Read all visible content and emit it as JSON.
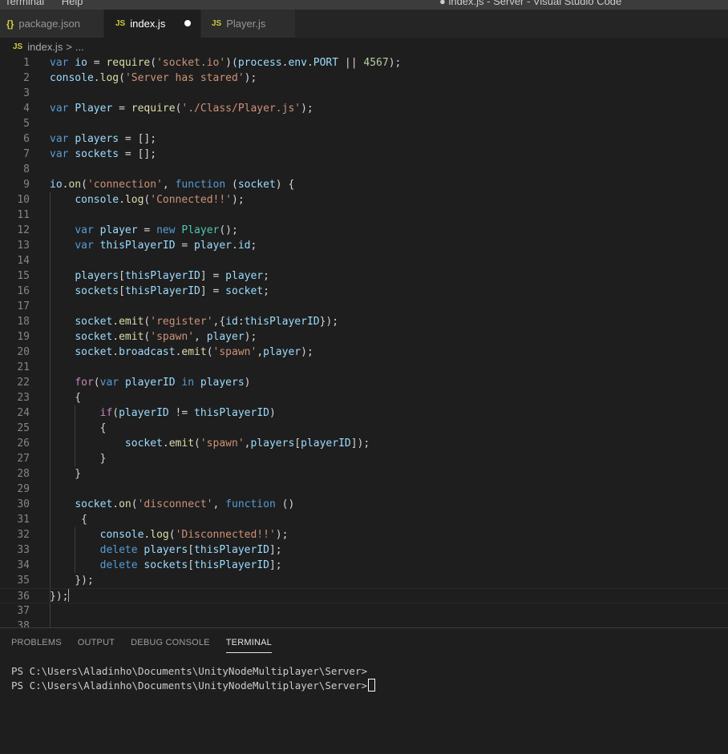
{
  "menu": {
    "items": [
      "Terminal",
      "Help"
    ]
  },
  "window_title": "● index.js - Server - Visual Studio Code",
  "tabs": [
    {
      "icon": "{}",
      "label": "package.json",
      "active": false
    },
    {
      "icon": "JS",
      "label": "index.js",
      "active": true,
      "modified": true
    },
    {
      "icon": "JS",
      "label": "Player.js",
      "active": false
    }
  ],
  "breadcrumb": {
    "icon": "JS",
    "file": "index.js",
    "sep": ">",
    "more": "..."
  },
  "editor": {
    "line_numbers": [
      "1",
      "2",
      "3",
      "4",
      "5",
      "6",
      "7",
      "8",
      "9",
      "10",
      "11",
      "12",
      "13",
      "14",
      "15",
      "16",
      "17",
      "18",
      "19",
      "20",
      "21",
      "22",
      "23",
      "24",
      "25",
      "26",
      "27",
      "28",
      "29",
      "30",
      "31",
      "32",
      "33",
      "34",
      "35",
      "36",
      "37",
      "38"
    ],
    "current_line": 36,
    "lines": [
      [
        [
          "kw",
          "var "
        ],
        [
          "vr",
          "io"
        ],
        [
          "pn",
          " = "
        ],
        [
          "fn",
          "require"
        ],
        [
          "pn",
          "("
        ],
        [
          "str",
          "'socket.io'"
        ],
        [
          "pn",
          ")("
        ],
        [
          "vr",
          "process"
        ],
        [
          "pn",
          "."
        ],
        [
          "vr",
          "env"
        ],
        [
          "pn",
          "."
        ],
        [
          "vr",
          "PORT"
        ],
        [
          "pn",
          " || "
        ],
        [
          "num",
          "4567"
        ],
        [
          "pn",
          ");"
        ]
      ],
      [
        [
          "vr",
          "console"
        ],
        [
          "pn",
          "."
        ],
        [
          "fn",
          "log"
        ],
        [
          "pn",
          "("
        ],
        [
          "str",
          "'Server has stared'"
        ],
        [
          "pn",
          ");"
        ]
      ],
      [],
      [
        [
          "kw",
          "var "
        ],
        [
          "vr",
          "Player"
        ],
        [
          "pn",
          " = "
        ],
        [
          "fn",
          "require"
        ],
        [
          "pn",
          "("
        ],
        [
          "str",
          "'./Class/Player.js'"
        ],
        [
          "pn",
          ");"
        ]
      ],
      [],
      [
        [
          "kw",
          "var "
        ],
        [
          "vr",
          "players"
        ],
        [
          "pn",
          " = [];"
        ]
      ],
      [
        [
          "kw",
          "var "
        ],
        [
          "vr",
          "sockets"
        ],
        [
          "pn",
          " = [];"
        ]
      ],
      [],
      [
        [
          "vr",
          "io"
        ],
        [
          "pn",
          "."
        ],
        [
          "fn",
          "on"
        ],
        [
          "pn",
          "("
        ],
        [
          "str",
          "'connection'"
        ],
        [
          "pn",
          ", "
        ],
        [
          "kw",
          "function"
        ],
        [
          "pn",
          " ("
        ],
        [
          "vr",
          "socket"
        ],
        [
          "pn",
          ") {"
        ]
      ],
      [
        [
          "pn",
          "    "
        ],
        [
          "vr",
          "console"
        ],
        [
          "pn",
          "."
        ],
        [
          "fn",
          "log"
        ],
        [
          "pn",
          "("
        ],
        [
          "str",
          "'Connected!!'"
        ],
        [
          "pn",
          ");"
        ]
      ],
      [],
      [
        [
          "pn",
          "    "
        ],
        [
          "kw",
          "var "
        ],
        [
          "vr",
          "player"
        ],
        [
          "pn",
          " = "
        ],
        [
          "kw",
          "new "
        ],
        [
          "cls",
          "Player"
        ],
        [
          "pn",
          "();"
        ]
      ],
      [
        [
          "pn",
          "    "
        ],
        [
          "kw",
          "var "
        ],
        [
          "vr",
          "thisPlayerID"
        ],
        [
          "pn",
          " = "
        ],
        [
          "vr",
          "player"
        ],
        [
          "pn",
          "."
        ],
        [
          "vr",
          "id"
        ],
        [
          "pn",
          ";"
        ]
      ],
      [],
      [
        [
          "pn",
          "    "
        ],
        [
          "vr",
          "players"
        ],
        [
          "pn",
          "["
        ],
        [
          "vr",
          "thisPlayerID"
        ],
        [
          "pn",
          "] = "
        ],
        [
          "vr",
          "player"
        ],
        [
          "pn",
          ";"
        ]
      ],
      [
        [
          "pn",
          "    "
        ],
        [
          "vr",
          "sockets"
        ],
        [
          "pn",
          "["
        ],
        [
          "vr",
          "thisPlayerID"
        ],
        [
          "pn",
          "] = "
        ],
        [
          "vr",
          "socket"
        ],
        [
          "pn",
          ";"
        ]
      ],
      [],
      [
        [
          "pn",
          "    "
        ],
        [
          "vr",
          "socket"
        ],
        [
          "pn",
          "."
        ],
        [
          "fn",
          "emit"
        ],
        [
          "pn",
          "("
        ],
        [
          "str",
          "'register'"
        ],
        [
          "pn",
          ",{"
        ],
        [
          "vr",
          "id"
        ],
        [
          "pn",
          ":"
        ],
        [
          "vr",
          "thisPlayerID"
        ],
        [
          "pn",
          "});"
        ]
      ],
      [
        [
          "pn",
          "    "
        ],
        [
          "vr",
          "socket"
        ],
        [
          "pn",
          "."
        ],
        [
          "fn",
          "emit"
        ],
        [
          "pn",
          "("
        ],
        [
          "str",
          "'spawn'"
        ],
        [
          "pn",
          ", "
        ],
        [
          "vr",
          "player"
        ],
        [
          "pn",
          ");"
        ]
      ],
      [
        [
          "pn",
          "    "
        ],
        [
          "vr",
          "socket"
        ],
        [
          "pn",
          "."
        ],
        [
          "vr",
          "broadcast"
        ],
        [
          "pn",
          "."
        ],
        [
          "fn",
          "emit"
        ],
        [
          "pn",
          "("
        ],
        [
          "str",
          "'spawn'"
        ],
        [
          "pn",
          ","
        ],
        [
          "vr",
          "player"
        ],
        [
          "pn",
          ");"
        ]
      ],
      [],
      [
        [
          "pn",
          "    "
        ],
        [
          "ctl",
          "for"
        ],
        [
          "pn",
          "("
        ],
        [
          "kw",
          "var "
        ],
        [
          "vr",
          "playerID"
        ],
        [
          "kw",
          " in "
        ],
        [
          "vr",
          "players"
        ],
        [
          "pn",
          ")"
        ]
      ],
      [
        [
          "pn",
          "    {"
        ]
      ],
      [
        [
          "pn",
          "        "
        ],
        [
          "ctl",
          "if"
        ],
        [
          "pn",
          "("
        ],
        [
          "vr",
          "playerID"
        ],
        [
          "pn",
          " != "
        ],
        [
          "vr",
          "thisPlayerID"
        ],
        [
          "pn",
          ")"
        ]
      ],
      [
        [
          "pn",
          "        {"
        ]
      ],
      [
        [
          "pn",
          "            "
        ],
        [
          "vr",
          "socket"
        ],
        [
          "pn",
          "."
        ],
        [
          "fn",
          "emit"
        ],
        [
          "pn",
          "("
        ],
        [
          "str",
          "'spawn'"
        ],
        [
          "pn",
          ","
        ],
        [
          "vr",
          "players"
        ],
        [
          "pn",
          "["
        ],
        [
          "vr",
          "playerID"
        ],
        [
          "pn",
          "]);"
        ]
      ],
      [
        [
          "pn",
          "        }"
        ]
      ],
      [
        [
          "pn",
          "    }"
        ]
      ],
      [],
      [
        [
          "pn",
          "    "
        ],
        [
          "vr",
          "socket"
        ],
        [
          "pn",
          "."
        ],
        [
          "fn",
          "on"
        ],
        [
          "pn",
          "("
        ],
        [
          "str",
          "'disconnect'"
        ],
        [
          "pn",
          ", "
        ],
        [
          "kw",
          "function"
        ],
        [
          "pn",
          " ()"
        ]
      ],
      [
        [
          "pn",
          "     {"
        ]
      ],
      [
        [
          "pn",
          "        "
        ],
        [
          "vr",
          "console"
        ],
        [
          "pn",
          "."
        ],
        [
          "fn",
          "log"
        ],
        [
          "pn",
          "("
        ],
        [
          "str",
          "'Disconnected!!'"
        ],
        [
          "pn",
          ");"
        ]
      ],
      [
        [
          "pn",
          "        "
        ],
        [
          "kw",
          "delete "
        ],
        [
          "vr",
          "players"
        ],
        [
          "pn",
          "["
        ],
        [
          "vr",
          "thisPlayerID"
        ],
        [
          "pn",
          "];"
        ]
      ],
      [
        [
          "pn",
          "        "
        ],
        [
          "kw",
          "delete "
        ],
        [
          "vr",
          "sockets"
        ],
        [
          "pn",
          "["
        ],
        [
          "vr",
          "thisPlayerID"
        ],
        [
          "pn",
          "];"
        ]
      ],
      [
        [
          "pn",
          "    });"
        ]
      ],
      [
        [
          "pn",
          "});"
        ]
      ],
      [],
      []
    ]
  },
  "panel": {
    "tabs": [
      "PROBLEMS",
      "OUTPUT",
      "DEBUG CONSOLE",
      "TERMINAL"
    ],
    "active_tab": "TERMINAL",
    "terminal_lines": [
      "PS C:\\Users\\Aladinho\\Documents\\UnityNodeMultiplayer\\Server>",
      "PS C:\\Users\\Aladinho\\Documents\\UnityNodeMultiplayer\\Server>"
    ]
  }
}
